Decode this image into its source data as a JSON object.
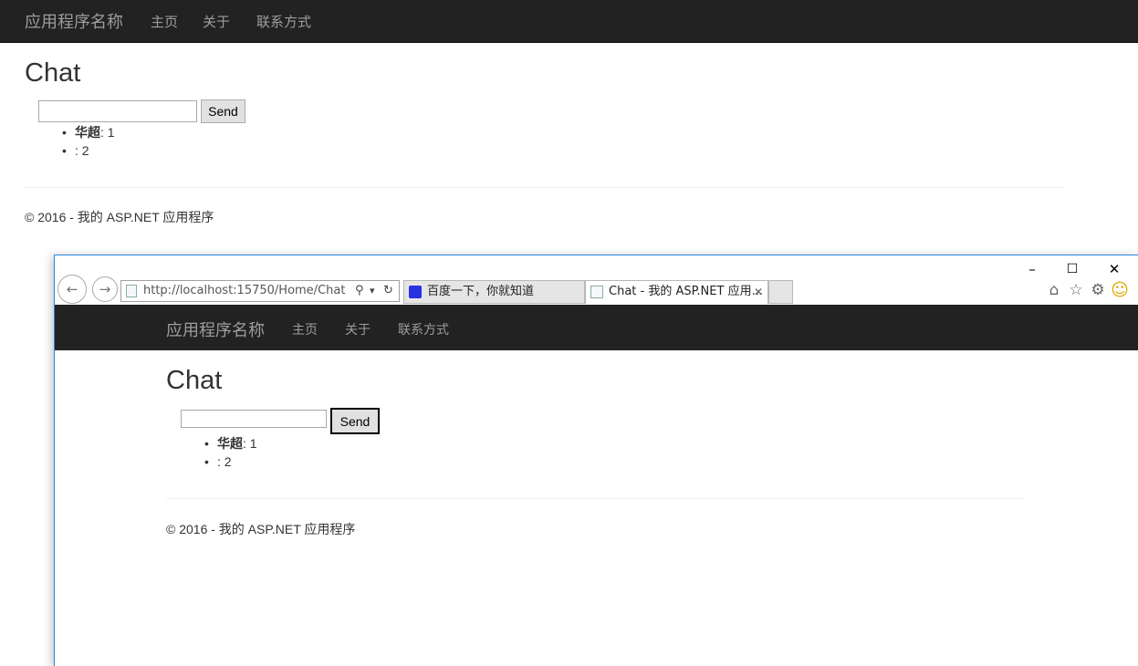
{
  "page": {
    "brand": "应用程序名称",
    "nav": [
      "主页",
      "关于",
      "联系方式"
    ],
    "title": "Chat",
    "input_value": "",
    "send_label": "Send",
    "messages": [
      {
        "name": "华超",
        "text": ": 1"
      },
      {
        "name": "",
        "text": ": 2"
      }
    ],
    "bullet": "•",
    "footer": "© 2016 - 我的 ASP.NET 应用程序"
  },
  "browser": {
    "controls": {
      "minimize": "–",
      "maximize": "☐",
      "close": "✕"
    },
    "back_icon": "←",
    "forward_icon": "→",
    "address": "http://localhost:15750/Home/Chat",
    "search_glyph": "⚲",
    "dropdown_glyph": "▾",
    "refresh_glyph": "↻",
    "tabs": [
      {
        "label": "百度一下，你就知道",
        "active": false
      },
      {
        "label": "Chat - 我的 ASP.NET 应用...",
        "active": true
      }
    ],
    "tab_close": "✕",
    "toolbar_icons": {
      "home": "⌂",
      "favorites": "☆",
      "settings": "⚙",
      "smiley": "☺"
    }
  },
  "colors": {
    "navbar": "#222222",
    "nav_text": "#9d9d9d",
    "window_border": "#2b88d8",
    "smiley": "#f0c000"
  }
}
